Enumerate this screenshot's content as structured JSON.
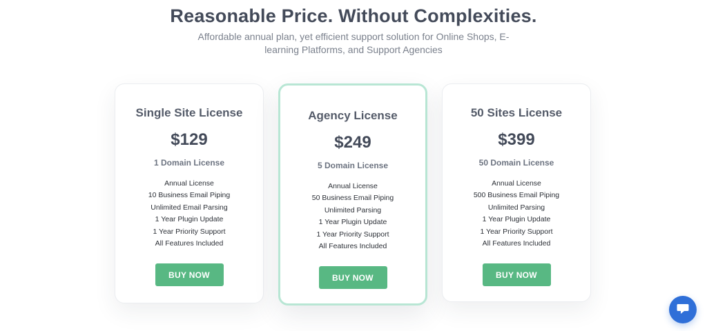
{
  "header": {
    "title": "Reasonable Price. Without Complexities.",
    "subtitle": "Affordable annual plan, yet efficient support solution for Online Shops, E-learning Platforms, and Support Agencies"
  },
  "plans": [
    {
      "name": "Single Site License",
      "price": "$129",
      "domains": "1 Domain License",
      "features": [
        "Annual License",
        "10 Business Email Piping",
        "Unlimited Email Parsing",
        "1 Year Plugin Update",
        "1 Year Priority Support",
        "All Features Included"
      ],
      "button": "BUY NOW",
      "featured": false
    },
    {
      "name": "Agency License",
      "price": "$249",
      "domains": "5 Domain License",
      "features": [
        "Annual License",
        "50 Business Email Piping",
        "Unlimited Parsing",
        "1 Year Plugin Update",
        "1 Year Priority Support",
        "All Features Included"
      ],
      "button": "BUY NOW",
      "featured": true
    },
    {
      "name": "50 Sites License",
      "price": "$399",
      "domains": "50 Domain License",
      "features": [
        "Annual License",
        "500 Business Email Piping",
        "Unlimited Parsing",
        "1 Year Plugin Update",
        "1 Year Priority Support",
        "All Features Included"
      ],
      "button": "BUY NOW",
      "featured": false
    }
  ],
  "chat": {
    "icon": "chat-bubble-icon"
  },
  "colors": {
    "accent_button": "#58b883",
    "featured_border": "#b8e6d4",
    "chat_button": "#2f6fd8",
    "heading": "#434a59"
  }
}
